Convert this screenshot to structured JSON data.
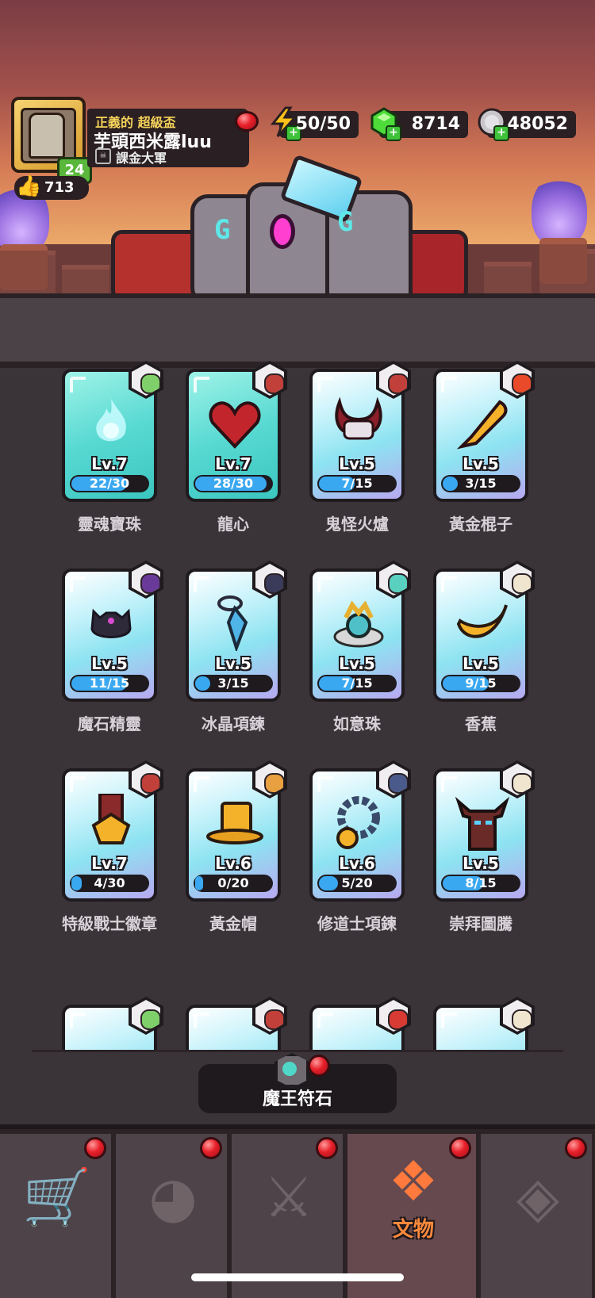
{
  "player": {
    "title_prefix": "正義的 超級盃",
    "name": "芋頭西米露luu",
    "guild": "課金大軍",
    "level": "24",
    "likes": "713"
  },
  "resources": {
    "energy": "50/50",
    "gems": "8714",
    "coins": "48052"
  },
  "cards": [
    {
      "name": "靈魂寶珠",
      "level": "Lv.7",
      "progress": "22/30",
      "fill": 0.733,
      "style": "teal",
      "icon": "soul-flame-icon"
    },
    {
      "name": "龍心",
      "level": "Lv.7",
      "progress": "28/30",
      "fill": 0.933,
      "style": "teal",
      "icon": "dragon-heart-icon"
    },
    {
      "name": "鬼怪火爐",
      "level": "Lv.5",
      "progress": "7/15",
      "fill": 0.467,
      "style": "blue",
      "icon": "demon-furnace-icon"
    },
    {
      "name": "黃金棍子",
      "level": "Lv.5",
      "progress": "3/15",
      "fill": 0.2,
      "style": "blue",
      "icon": "golden-club-icon"
    },
    {
      "name": "魔石精靈",
      "level": "Lv.5",
      "progress": "11/15",
      "fill": 0.733,
      "style": "blue",
      "icon": "magic-stone-spirit-icon"
    },
    {
      "name": "冰晶項鍊",
      "level": "Lv.5",
      "progress": "3/15",
      "fill": 0.2,
      "style": "blue",
      "icon": "ice-crystal-necklace-icon"
    },
    {
      "name": "如意珠",
      "level": "Lv.5",
      "progress": "7/15",
      "fill": 0.467,
      "style": "blue",
      "icon": "wish-pearl-icon"
    },
    {
      "name": "香蕉",
      "level": "Lv.5",
      "progress": "9/15",
      "fill": 0.6,
      "style": "blue",
      "icon": "banana-icon"
    },
    {
      "name": "特級戰士徽章",
      "level": "Lv.7",
      "progress": "4/30",
      "fill": 0.133,
      "style": "blue",
      "icon": "warrior-badge-icon"
    },
    {
      "name": "黃金帽",
      "level": "Lv.6",
      "progress": "0/20",
      "fill": 0,
      "style": "blue",
      "icon": "golden-hat-icon"
    },
    {
      "name": "修道士項鍊",
      "level": "Lv.6",
      "progress": "5/20",
      "fill": 0.25,
      "style": "blue",
      "icon": "monk-necklace-icon"
    },
    {
      "name": "崇拜圖騰",
      "level": "Lv.5",
      "progress": "8/15",
      "fill": 0.533,
      "style": "blue",
      "icon": "worship-totem-icon"
    }
  ],
  "rune_button": {
    "label": "魔王符石"
  },
  "nav": [
    {
      "icon": "shop-cart-icon",
      "label": "",
      "active": false
    },
    {
      "icon": "monster-face-icon",
      "label": "",
      "active": false
    },
    {
      "icon": "crossed-swords-icon",
      "label": "",
      "active": false
    },
    {
      "icon": "relic-emblem-icon",
      "label": "文物",
      "active": true
    },
    {
      "icon": "ticket-icon",
      "label": "",
      "active": false
    }
  ],
  "colors": {
    "progress_fill": "#3aa8f0",
    "active_tab_accent": "#ff7a3c",
    "notification_red": "#e8202a"
  }
}
